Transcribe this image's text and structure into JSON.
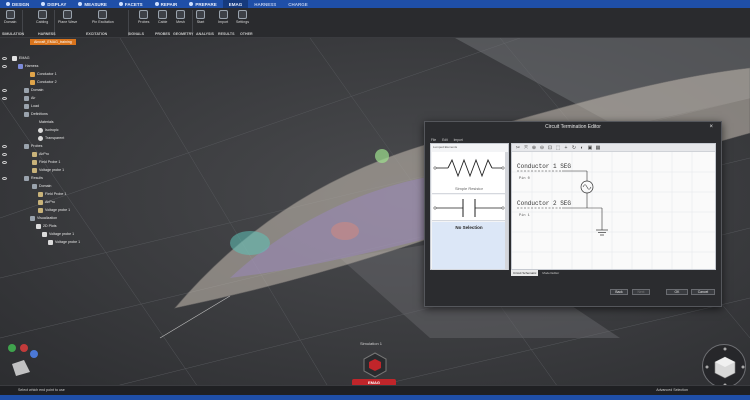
{
  "menubar": {
    "tabs": [
      {
        "label": "DESIGN"
      },
      {
        "label": "DISPLAY"
      },
      {
        "label": "MEASURE"
      },
      {
        "label": "FACETS"
      },
      {
        "label": "REPAIR"
      },
      {
        "label": "PREPARE"
      },
      {
        "label": "EMAG"
      },
      {
        "label": "HARNESS"
      },
      {
        "label": "CHARGE"
      }
    ]
  },
  "ribbon": {
    "buttons": [
      {
        "label": "Domain"
      },
      {
        "label": "Cabling"
      },
      {
        "label": "Plane Wave"
      },
      {
        "label": "Pin Excitation"
      },
      {
        "label": "Probes"
      },
      {
        "label": "Cable"
      },
      {
        "label": "Mesh"
      },
      {
        "label": "Start"
      },
      {
        "label": "Import"
      },
      {
        "label": "Settings"
      }
    ],
    "groups": [
      {
        "label": "SIMULATION"
      },
      {
        "label": "HARNESS"
      },
      {
        "label": "EXCITATION"
      },
      {
        "label": "SIGNALS"
      },
      {
        "label": "PROBES"
      },
      {
        "label": "GEOMETRY"
      },
      {
        "label": "ANALYSIS"
      },
      {
        "label": "RESULTS"
      },
      {
        "label": "OTHER"
      }
    ]
  },
  "project_tab": "Aircraft_EMAG_training",
  "tree": [
    {
      "label": "EMAG",
      "depth": 0
    },
    {
      "label": "Harness",
      "depth": 1
    },
    {
      "label": "Conductor 1",
      "depth": 2
    },
    {
      "label": "Conductor 2",
      "depth": 2
    },
    {
      "label": "Domain",
      "depth": 1
    },
    {
      "label": "Air",
      "depth": 1
    },
    {
      "label": "Load",
      "depth": 1
    },
    {
      "label": "Definitions",
      "depth": 1
    },
    {
      "label": "Materials",
      "depth": 2
    },
    {
      "label": "Isotropic",
      "depth": 3
    },
    {
      "label": "Transparent",
      "depth": 3
    },
    {
      "label": "Probes",
      "depth": 1
    },
    {
      "label": "AirPro",
      "depth": 2
    },
    {
      "label": "Field Probe 1",
      "depth": 2
    },
    {
      "label": "Voltage probe 1",
      "depth": 2
    },
    {
      "label": "Results",
      "depth": 1
    },
    {
      "label": "Domain",
      "depth": 2
    },
    {
      "label": "Field Probe 1",
      "depth": 3
    },
    {
      "label": "AirPro",
      "depth": 3
    },
    {
      "label": "Voltage probe 1",
      "depth": 3
    },
    {
      "label": "Visualization",
      "depth": 2
    },
    {
      "label": "2D Plots",
      "depth": 3
    },
    {
      "label": "Voltage probe 1",
      "depth": 4
    },
    {
      "label": "Voltage probe 1",
      "depth": 5
    }
  ],
  "dialog": {
    "title": "Circuit Termination Editor",
    "close": "×",
    "menu": [
      "File",
      "Edit",
      "Import"
    ],
    "library_header": "Lumped Elements",
    "library": [
      {
        "label": "Simple Resistor"
      },
      {
        "label": ""
      },
      {
        "label": "No Selection"
      }
    ],
    "schematic": {
      "conductor1": "Conductor 1 SEG",
      "conductor2": "Conductor 2 SEG",
      "pin1": "Pin 0",
      "pin2": "Pin 1"
    },
    "bottom_tabs": [
      "Circuit Schematic",
      "Model Editor"
    ],
    "buttons": {
      "back": "Back",
      "next": "Next",
      "ok": "OK",
      "cancel": "Cancel"
    }
  },
  "simulation_label": "Simulation 1",
  "emag_badge": "EMAG",
  "status": {
    "left": "Select which end point to use",
    "right": "Advanced Selection"
  },
  "colors": {
    "menubar": "#1f4fa8",
    "accent_tab": "#d9741c",
    "emag_badge": "#c0252a"
  }
}
